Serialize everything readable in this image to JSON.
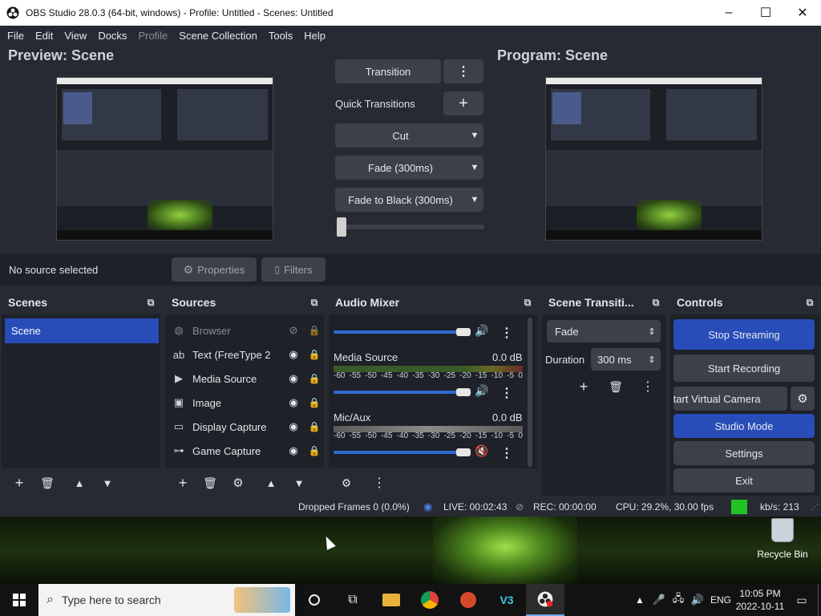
{
  "window": {
    "title": "OBS Studio 28.0.3 (64-bit, windows) - Profile: Untitled - Scenes: Untitled"
  },
  "menu": [
    "File",
    "Edit",
    "View",
    "Docks",
    "Profile",
    "Scene Collection",
    "Tools",
    "Help"
  ],
  "preview": {
    "title": "Preview: Scene"
  },
  "program": {
    "title": "Program: Scene"
  },
  "transitions": {
    "transition_label": "Transition",
    "quick_label": "Quick Transitions",
    "cut_label": "Cut",
    "fade_label": "Fade (300ms)",
    "fade_black_label": "Fade to Black (300ms)",
    "t_bar_value": 0
  },
  "source_bar": {
    "status": "No source selected",
    "properties_label": "Properties",
    "filters_label": "Filters"
  },
  "scenes_dock": {
    "title": "Scenes",
    "items": [
      "Scene"
    ]
  },
  "sources_dock": {
    "title": "Sources",
    "items": [
      {
        "name": "Browser",
        "visible": false
      },
      {
        "name": "Text (FreeType 2",
        "visible": true
      },
      {
        "name": "Media Source",
        "visible": true
      },
      {
        "name": "Image",
        "visible": true
      },
      {
        "name": "Display Capture",
        "visible": true
      },
      {
        "name": "Game Capture",
        "visible": true
      }
    ]
  },
  "audio_dock": {
    "title": "Audio Mixer",
    "tick_labels": [
      "-60",
      "-55",
      "-50",
      "-45",
      "-40",
      "-35",
      "-30",
      "-25",
      "-20",
      "-15",
      "-10",
      "-5",
      "0"
    ],
    "channels": [
      {
        "name": "Media Source",
        "db": "0.0 dB",
        "muted": false
      },
      {
        "name": "Mic/Aux",
        "db": "0.0 dB",
        "muted": true
      }
    ]
  },
  "scene_trans_dock": {
    "title": "Scene Transiti...",
    "selected": "Fade",
    "duration_label": "Duration",
    "duration_value": "300 ms"
  },
  "controls_dock": {
    "title": "Controls",
    "stop_streaming": "Stop Streaming",
    "start_recording": "Start Recording",
    "virtual_camera": "Start Virtual Camera",
    "studio_mode": "Studio Mode",
    "settings": "Settings",
    "exit": "Exit"
  },
  "status": {
    "dropped_frames": "Dropped Frames 0 (0.0%)",
    "live": "LIVE: 00:02:43",
    "rec": "REC: 00:00:00",
    "cpu": "CPU: 29.2%, 30.00 fps",
    "bitrate": "kb/s: 213"
  },
  "desktop": {
    "recycle_bin": "Recycle Bin"
  },
  "taskbar": {
    "search_placeholder": "Type here to search",
    "lang": "ENG",
    "time": "10:05 PM",
    "date": "2022-10-11"
  },
  "colors": {
    "accent_blue": "#284cb8",
    "panel": "#1e2128",
    "bg": "#272a33",
    "bitrate_indicator": "#22c322",
    "mute_red": "#d12a2a"
  }
}
